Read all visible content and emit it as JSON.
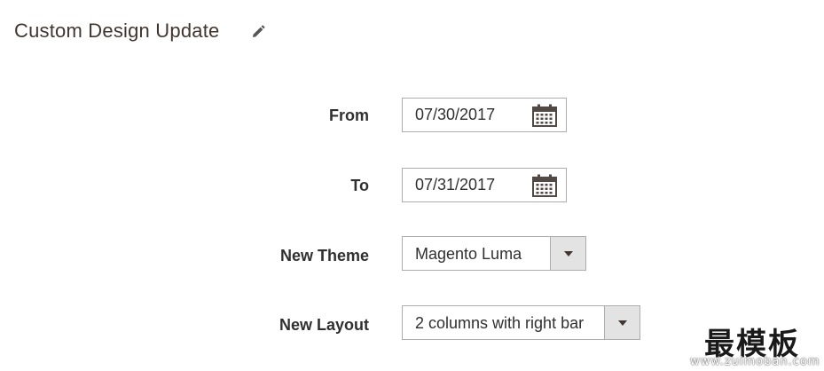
{
  "section": {
    "title": "Custom Design Update",
    "edit_icon": "pencil-icon"
  },
  "fields": {
    "from": {
      "label": "From",
      "value": "07/30/2017",
      "icon": "calendar-icon"
    },
    "to": {
      "label": "To",
      "value": "07/31/2017",
      "icon": "calendar-icon"
    },
    "new_theme": {
      "label": "New Theme",
      "value": "Magento Luma",
      "icon": "chevron-down-icon"
    },
    "new_layout": {
      "label": "New Layout",
      "value": "2 columns with right bar",
      "icon": "chevron-down-icon"
    }
  },
  "watermark": {
    "main": "最模板",
    "sub": "www.zuimoban.com"
  },
  "colors": {
    "text": "#303030",
    "title": "#41362f",
    "border": "#adadad",
    "select_button": "#e3e3e3"
  }
}
